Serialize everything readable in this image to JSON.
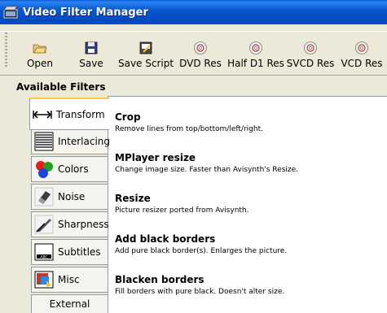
{
  "window": {
    "title": "Video Filter Manager"
  },
  "toolbar": {
    "buttons": [
      {
        "label": "Open",
        "icon": "folder-open-icon"
      },
      {
        "label": "Save",
        "icon": "floppy-disk-icon"
      },
      {
        "label": "Save Script",
        "icon": "script-icon"
      },
      {
        "label": "DVD Res",
        "icon": "disc-icon"
      },
      {
        "label": "Half D1 Res",
        "icon": "disc-icon"
      },
      {
        "label": "SVCD Res",
        "icon": "disc-icon"
      },
      {
        "label": "VCD Res",
        "icon": "disc-icon"
      }
    ]
  },
  "section": {
    "label": "Available Filters"
  },
  "tabs": [
    {
      "label": "Transform",
      "icon": "transform-arrows-icon",
      "active": true
    },
    {
      "label": "Interlacing",
      "icon": "interlace-lines-icon",
      "active": false
    },
    {
      "label": "Colors",
      "icon": "color-balls-icon",
      "active": false
    },
    {
      "label": "Noise",
      "icon": "eraser-icon",
      "active": false
    },
    {
      "label": "Sharpness",
      "icon": "knife-icon",
      "active": false
    },
    {
      "label": "Subtitles",
      "icon": "subtitle-box-icon",
      "active": false
    },
    {
      "label": "Misc",
      "icon": "misc-picture-icon",
      "active": false
    },
    {
      "label": "External",
      "icon": "",
      "active": false
    }
  ],
  "filters": [
    {
      "name": "Crop",
      "description": "Remove lines from top/bottom/left/right."
    },
    {
      "name": "MPlayer resize",
      "description": "Change image size. Faster than Avisynth's Resize."
    },
    {
      "name": "Resize",
      "description": "Picture resizer ported from Avisynth."
    },
    {
      "name": "Add black borders",
      "description": "Add pure black border(s). Enlarges the picture."
    },
    {
      "name": "Blacken borders",
      "description": "Fill borders with pure black. Doesn't alter size."
    }
  ],
  "colors": {
    "titlebar": "#0a58d0",
    "active_tab_accent": "#ffc83c",
    "panel_bg": "#ffffff",
    "window_bg": "#ece9d8"
  }
}
